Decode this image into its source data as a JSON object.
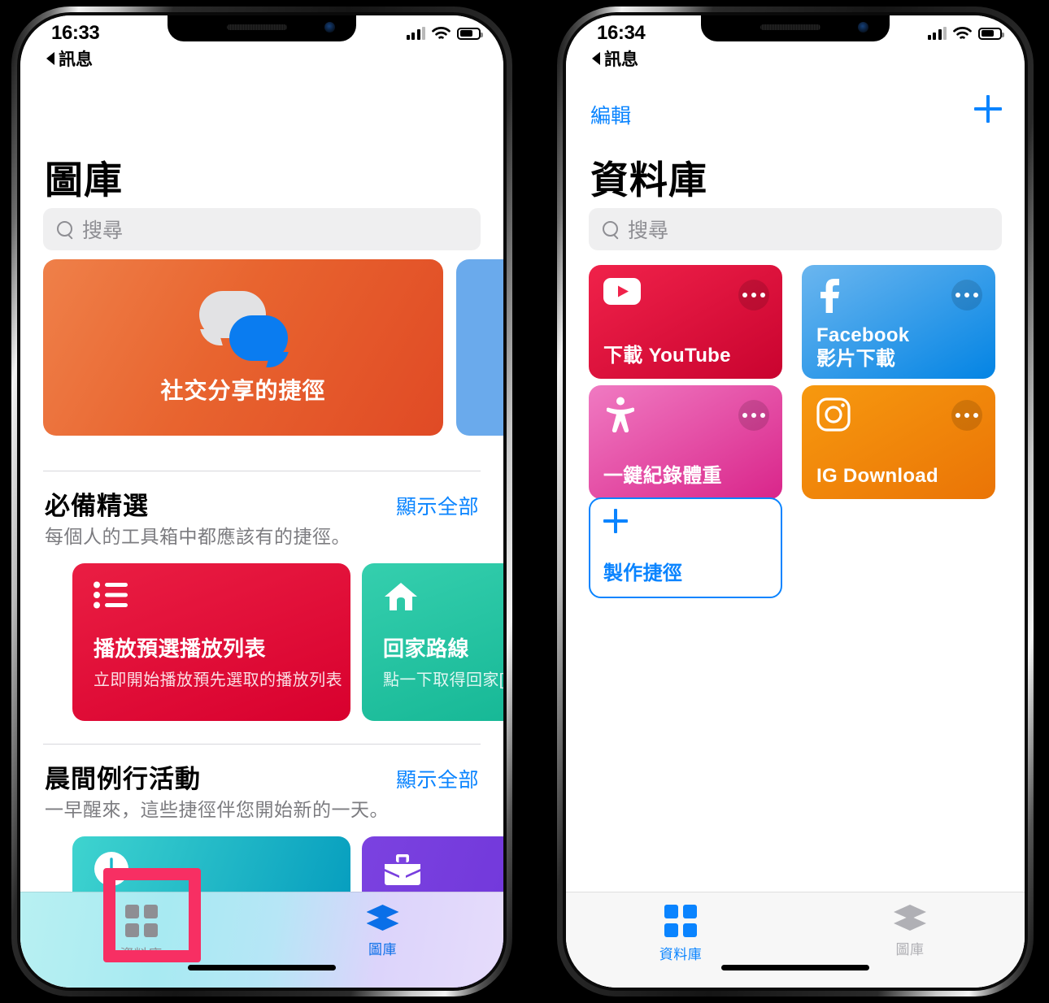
{
  "phones": [
    {
      "id": "gallery-phone",
      "status": {
        "time": "16:33",
        "back_label": "訊息",
        "signal_bars": 4,
        "signal_filled": 3,
        "wifi": "wifi-icon",
        "battery": "battery-icon"
      },
      "nav": {
        "title": "圖庫"
      },
      "search": {
        "placeholder": "搜尋",
        "icon": "search-icon"
      },
      "banner": {
        "label": "社交分享的捷徑",
        "icon": "chat-bubbles-icon",
        "color": "#e8642f",
        "peek_color": "#6aaaec"
      },
      "sections": [
        {
          "title": "必備精選",
          "more": "顯示全部",
          "subtitle": "每個人的工具箱中都應該有的捷徑。",
          "cards": [
            {
              "title": "播放預選播放列表",
              "subtitle": "立即開始播放預先選取的播放列表",
              "icon": "bullet-list-icon",
              "color": "#e8203f"
            },
            {
              "title": "回家路線",
              "subtitle": "點一下取得回家[",
              "icon": "home-icon",
              "color": "#23c2a0"
            }
          ]
        },
        {
          "title": "晨間例行活動",
          "more": "顯示全部",
          "subtitle": "一早醒來，這些捷徑伴您開始新的一天。",
          "cards": [
            {
              "title": "",
              "subtitle": "",
              "icon": "clock-icon",
              "color": "#17b5cc"
            },
            {
              "title": "",
              "subtitle": "",
              "icon": "briefcase-icon",
              "color": "#7b42e0"
            }
          ]
        }
      ],
      "tabs": [
        {
          "label": "資料庫",
          "icon": "grid-icon",
          "active": false,
          "color": "#8e8e93"
        },
        {
          "label": "圖庫",
          "icon": "layers-icon",
          "active": true,
          "color": "#0a6fe8"
        }
      ],
      "highlight": {
        "color": "#f72f63",
        "target": "資料庫"
      }
    },
    {
      "id": "library-phone",
      "status": {
        "time": "16:34",
        "back_label": "訊息",
        "signal_bars": 4,
        "signal_filled": 3,
        "wifi": "wifi-icon",
        "battery": "battery-icon"
      },
      "nav": {
        "edit": "編輯",
        "add": "add-icon",
        "title": "資料庫"
      },
      "search": {
        "placeholder": "搜尋",
        "icon": "search-icon"
      },
      "shortcuts": [
        {
          "title_line1": "下載 YouTube",
          "title_line2": "",
          "icon": "youtube-icon",
          "color_from": "#f0224a",
          "color_to": "#cf0f36",
          "menu": "more-dots-icon"
        },
        {
          "title_line1": "Facebook",
          "title_line2": "影片下載",
          "icon": "facebook-icon",
          "color_from": "#62b1ee",
          "color_to": "#0a84e8",
          "menu": "more-dots-icon"
        },
        {
          "title_line1": "一鍵紀錄體重",
          "title_line2": "",
          "icon": "accessibility-icon",
          "color_from": "#f07ac2",
          "color_to": "#dc2a8d",
          "menu": "more-dots-icon"
        },
        {
          "title_line1": "IG Download",
          "title_line2": "",
          "icon": "instagram-icon",
          "color_from": "#f6950f",
          "color_to": "#ed7a08",
          "menu": "more-dots-icon"
        }
      ],
      "create": {
        "label": "製作捷徑",
        "icon": "plus-icon",
        "color": "#0a84ff"
      },
      "tabs": [
        {
          "label": "資料庫",
          "icon": "grid-icon",
          "active": true,
          "color": "#0a84ff"
        },
        {
          "label": "圖庫",
          "icon": "layers-icon",
          "active": false,
          "color": "#b0b0b5"
        }
      ]
    }
  ]
}
